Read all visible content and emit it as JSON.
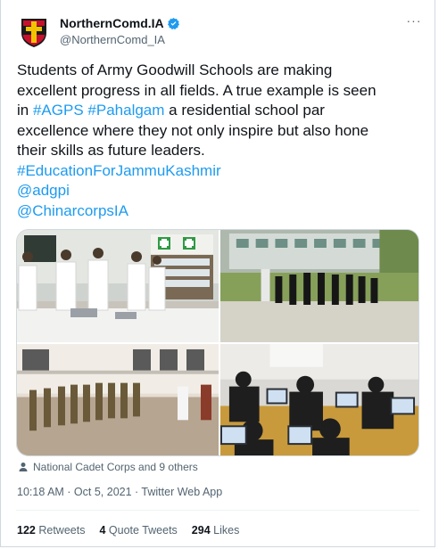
{
  "author": {
    "display_name": "NorthernComd.IA",
    "handle": "@NorthernComd_IA",
    "verified_icon": "verified-badge-icon",
    "avatar_icon": "regiment-crest-icon"
  },
  "menu": {
    "more_icon": "more-dots-icon",
    "more_label": "···"
  },
  "tweet": {
    "line1": "Students of Army Goodwill Schools are making",
    "line2": "excellent progress in all fields. A true example is seen",
    "line3_prefix": "in ",
    "hashtag1": "#AGPS",
    "hashtag2": "#Pahalgam",
    "line3_suffix": " a residential school par",
    "line4": "excellence where they not only inspire but also hone",
    "line5": "their skills as future leaders.",
    "hashtag3": "#EducationForJammuKashmir",
    "mention1": "@adgpi",
    "mention2": "@ChinarcorpsIA"
  },
  "tagged": {
    "icon": "person-icon",
    "text": "National Cadet Corps and 9 others"
  },
  "meta": {
    "timestamp": "10:18 AM · Oct 5, 2021 · Twitter Web App"
  },
  "stats": {
    "retweets_count": "122",
    "retweets_label": "Retweets",
    "quotes_count": "4",
    "quotes_label": "Quote Tweets",
    "likes_count": "294",
    "likes_label": "Likes"
  },
  "colors": {
    "link": "#1d9bf0",
    "secondary_text": "#536471",
    "border": "#cfd9de"
  }
}
